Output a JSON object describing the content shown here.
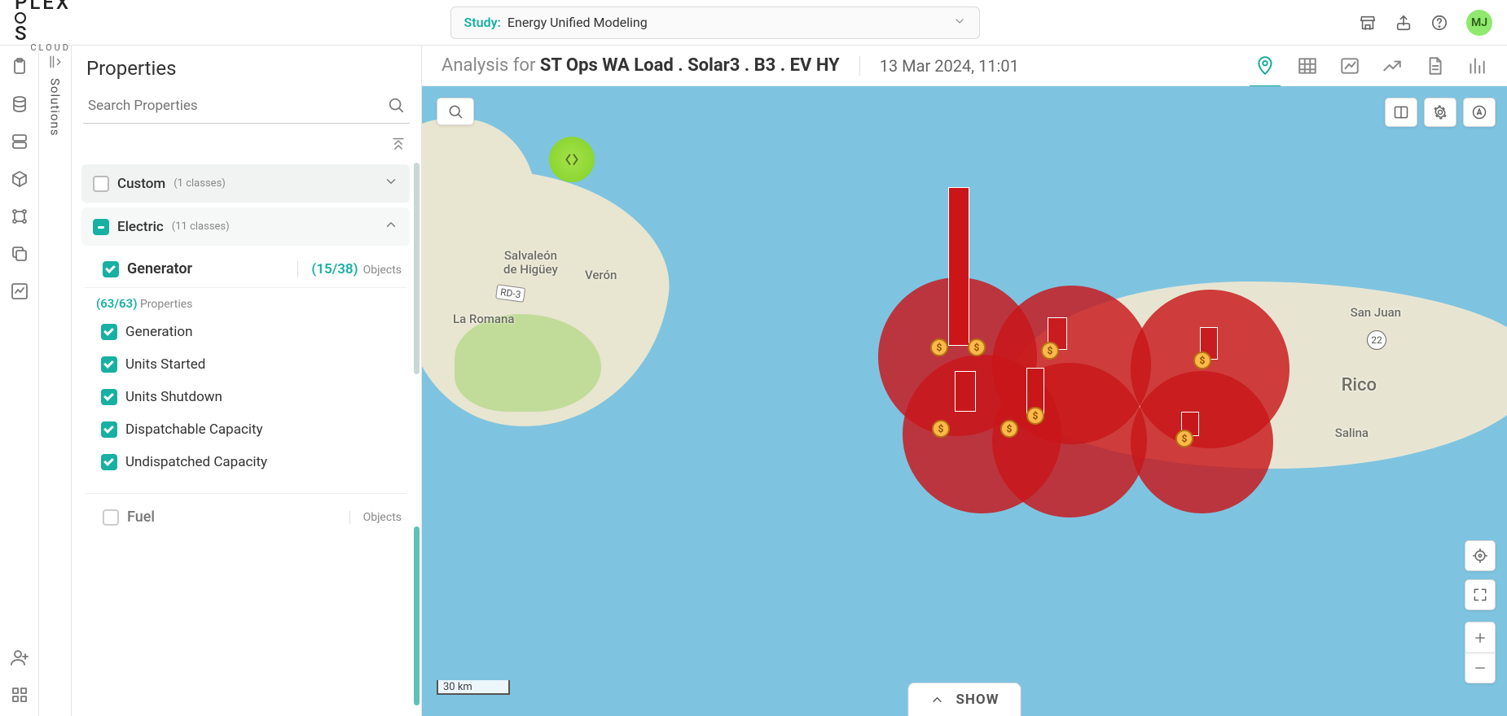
{
  "brand": {
    "name": "PLEXOS",
    "sub": "CLOUD"
  },
  "study": {
    "label": "Study:",
    "value": "Energy Unified Modeling"
  },
  "user": {
    "initials": "MJ"
  },
  "header": {
    "prefix": "Analysis for ",
    "title": "ST Ops WA Load . Solar3 . B3 . EV HY",
    "timestamp": "13 Mar 2024, 11:01"
  },
  "solutions_label": "Solutions",
  "properties": {
    "title": "Properties",
    "search_placeholder": "Search Properties",
    "groups": {
      "custom": {
        "name": "Custom",
        "meta": "(1 classes)"
      },
      "electric": {
        "name": "Electric",
        "meta": "(11 classes)"
      },
      "fuel": {
        "name": "Fuel",
        "objects_label": "Objects"
      }
    },
    "generator": {
      "name": "Generator",
      "objects_count": "(15/38)",
      "objects_label": "Objects"
    },
    "prop_count": {
      "count": "(63/63)",
      "label": "Properties"
    },
    "items": [
      "Generation",
      "Units Started",
      "Units Shutdown",
      "Dispatchable Capacity",
      "Undispatched Capacity"
    ]
  },
  "map": {
    "scale": "30 km",
    "show_label": "SHOW",
    "places": {
      "salvaleon": "Salvaleón\nde Higüey",
      "veron": "Verón",
      "laromana": "La Romana",
      "rd3": "RD-3",
      "sanjuan": "San Juan",
      "rico": "Rico",
      "salina": "Salina",
      "hwy22": "22"
    }
  }
}
